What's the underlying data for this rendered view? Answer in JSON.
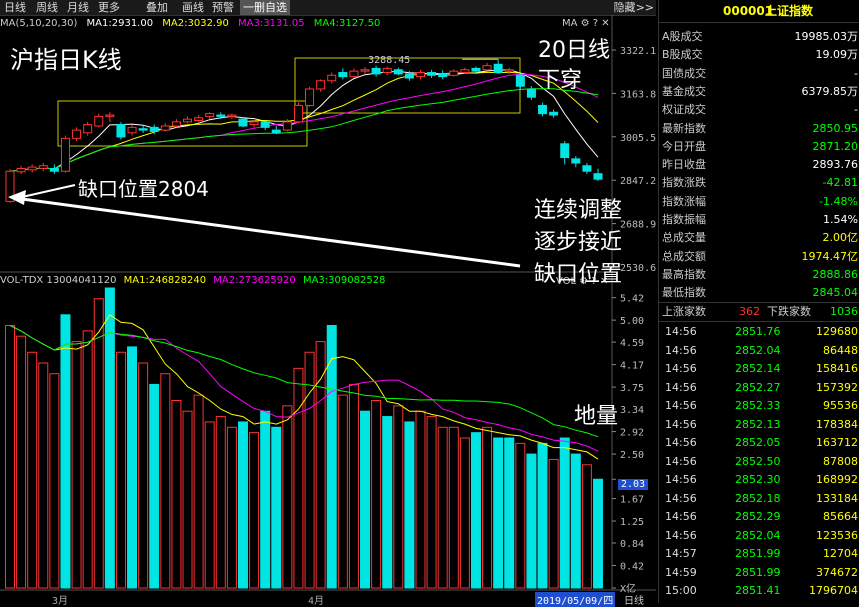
{
  "toolbar": {
    "tabs": [
      "日线",
      "周线",
      "月线",
      "更多",
      "叠加",
      "画线",
      "预警"
    ],
    "active_tab": "一删自选",
    "right_label": "隐藏",
    "right_arrows": ">>"
  },
  "kline": {
    "ma_legend": {
      "prefix": "MA(5,10,20,30)",
      "ma1": "MA1:2931.00",
      "ma2": "MA2:3032.90",
      "ma3": "MA3:3131.05",
      "ma4": "MA4:3127.50"
    },
    "price_axis": [
      "3322.13",
      "3163.84",
      "3005.55",
      "2847.26",
      "2688.98",
      "2530.69"
    ],
    "high_label": "3288.45",
    "top_icons": "MA ⚙ ? ✕"
  },
  "volume": {
    "legend": {
      "prefix": "VOL-TDX 13004041120",
      "ma1": "MA1:246828240",
      "ma2": "MA2:273625920",
      "ma3": "MA3:309082528"
    },
    "axis": [
      "5.42",
      "5.00",
      "4.59",
      "4.17",
      "3.75",
      "3.34",
      "2.92",
      "2.50",
      "2.03",
      "1.67",
      "1.25",
      "0.84",
      "0.42",
      "X亿"
    ],
    "current": "2.03",
    "top_icons": "VOL ⚙ ? ✕"
  },
  "date_axis": {
    "labels": [
      "3月",
      "4月"
    ],
    "current_date": "2019/05/09/四",
    "right_tab": "日线"
  },
  "annotations": {
    "title": "沪指日K线",
    "ma20_cross": [
      "20日线",
      "下穿"
    ],
    "gap": "缺口位置2804",
    "adjust": [
      "连续调整",
      "逐步接近",
      "缺口位置"
    ],
    "volume_note": "地量"
  },
  "colors": {
    "up": "#ff3232",
    "down": "#00e4e4",
    "ma1": "#ffffff",
    "ma2": "#ffff00",
    "ma3": "#ff00ff",
    "ma4": "#00ff00",
    "box": "#c8c800"
  },
  "panel": {
    "code": "000001",
    "name": "上证指数",
    "rows": [
      {
        "label": "A股成交",
        "value": "19985.03万",
        "color": "#ffffff"
      },
      {
        "label": "B股成交",
        "value": "19.09万",
        "color": "#ffffff"
      },
      {
        "label": "国债成交",
        "value": "-",
        "color": "#ffffff"
      },
      {
        "label": "基金成交",
        "value": "6379.85万",
        "color": "#ffffff"
      },
      {
        "label": "权证成交",
        "value": "-",
        "color": "#ffffff"
      },
      {
        "label": "最新指数",
        "value": "2850.95",
        "color": "#00ff00"
      },
      {
        "label": "今日开盘",
        "value": "2871.20",
        "color": "#00ff00"
      },
      {
        "label": "昨日收盘",
        "value": "2893.76",
        "color": "#ffffff"
      },
      {
        "label": "指数涨跌",
        "value": "-42.81",
        "color": "#00ff00"
      },
      {
        "label": "指数涨幅",
        "value": "-1.48%",
        "color": "#00ff00"
      },
      {
        "label": "指数振幅",
        "value": "1.54%",
        "color": "#ffffff"
      },
      {
        "label": "总成交量",
        "value": "2.00亿",
        "color": "#ffff00"
      },
      {
        "label": "总成交额",
        "value": "1974.47亿",
        "color": "#ffff00"
      },
      {
        "label": "最高指数",
        "value": "2888.86",
        "color": "#00ff00"
      },
      {
        "label": "最低指数",
        "value": "2845.04",
        "color": "#00ff00"
      }
    ],
    "rise_label": "上涨家数",
    "rise_value": "362",
    "fall_label": "下跌家数",
    "fall_value": "1036",
    "ticks": [
      {
        "time": "14:56",
        "price": "2851.76",
        "vol": "129680"
      },
      {
        "time": "14:56",
        "price": "2852.04",
        "vol": "86448"
      },
      {
        "time": "14:56",
        "price": "2852.14",
        "vol": "158416"
      },
      {
        "time": "14:56",
        "price": "2852.27",
        "vol": "157392"
      },
      {
        "time": "14:56",
        "price": "2852.33",
        "vol": "95536"
      },
      {
        "time": "14:56",
        "price": "2852.13",
        "vol": "178384"
      },
      {
        "time": "14:56",
        "price": "2852.05",
        "vol": "163712"
      },
      {
        "time": "14:56",
        "price": "2852.50",
        "vol": "87808"
      },
      {
        "time": "14:56",
        "price": "2852.30",
        "vol": "168992"
      },
      {
        "time": "14:56",
        "price": "2852.18",
        "vol": "133184"
      },
      {
        "time": "14:56",
        "price": "2852.29",
        "vol": "85664"
      },
      {
        "time": "14:56",
        "price": "2852.04",
        "vol": "123536"
      },
      {
        "time": "14:57",
        "price": "2851.99",
        "vol": "12704"
      },
      {
        "time": "14:59",
        "price": "2851.99",
        "vol": "374672"
      },
      {
        "time": "15:00",
        "price": "2851.41",
        "vol": "1796704"
      }
    ]
  },
  "chart_data": [
    {
      "type": "candlestick",
      "title": "",
      "price_axis_ticks": [
        3322.13,
        3163.84,
        3005.55,
        2847.26,
        2688.98,
        2530.69
      ],
      "ylim": [
        2530.69,
        3322.13
      ],
      "annotated_high": 3288.45,
      "gap_level": 2804,
      "candles": [
        {
          "o": 2770,
          "c": 2880,
          "h": 2888,
          "l": 2765
        },
        {
          "o": 2878,
          "c": 2890,
          "h": 2900,
          "l": 2870
        },
        {
          "o": 2885,
          "c": 2895,
          "h": 2905,
          "l": 2875
        },
        {
          "o": 2890,
          "c": 2900,
          "h": 2910,
          "l": 2880
        },
        {
          "o": 2890,
          "c": 2880,
          "h": 2905,
          "l": 2870
        },
        {
          "o": 2880,
          "c": 3000,
          "h": 3010,
          "l": 2875
        },
        {
          "o": 3000,
          "c": 3030,
          "h": 3040,
          "l": 2990
        },
        {
          "o": 3020,
          "c": 3050,
          "h": 3060,
          "l": 3010
        },
        {
          "o": 3045,
          "c": 3080,
          "h": 3090,
          "l": 3040
        },
        {
          "o": 3080,
          "c": 3085,
          "h": 3095,
          "l": 3060
        },
        {
          "o": 3050,
          "c": 3005,
          "h": 3060,
          "l": 2995
        },
        {
          "o": 3020,
          "c": 3040,
          "h": 3050,
          "l": 3010
        },
        {
          "o": 3035,
          "c": 3030,
          "h": 3045,
          "l": 3020
        },
        {
          "o": 3040,
          "c": 3025,
          "h": 3050,
          "l": 3015
        },
        {
          "o": 3030,
          "c": 3045,
          "h": 3055,
          "l": 3025
        },
        {
          "o": 3045,
          "c": 3060,
          "h": 3070,
          "l": 3040
        },
        {
          "o": 3060,
          "c": 3070,
          "h": 3080,
          "l": 3055
        },
        {
          "o": 3065,
          "c": 3075,
          "h": 3085,
          "l": 3060
        },
        {
          "o": 3080,
          "c": 3090,
          "h": 3095,
          "l": 3070
        },
        {
          "o": 3085,
          "c": 3080,
          "h": 3095,
          "l": 3070
        },
        {
          "o": 3080,
          "c": 3085,
          "h": 3090,
          "l": 3070
        },
        {
          "o": 3070,
          "c": 3045,
          "h": 3075,
          "l": 3040
        },
        {
          "o": 3050,
          "c": 3060,
          "h": 3065,
          "l": 3040
        },
        {
          "o": 3060,
          "c": 3040,
          "h": 3065,
          "l": 3030
        },
        {
          "o": 3030,
          "c": 3020,
          "h": 3045,
          "l": 3015
        },
        {
          "o": 3030,
          "c": 3060,
          "h": 3070,
          "l": 3025
        },
        {
          "o": 3060,
          "c": 3120,
          "h": 3130,
          "l": 3055
        },
        {
          "o": 3120,
          "c": 3180,
          "h": 3188,
          "l": 3115
        },
        {
          "o": 3180,
          "c": 3210,
          "h": 3215,
          "l": 3170
        },
        {
          "o": 3210,
          "c": 3230,
          "h": 3240,
          "l": 3200
        },
        {
          "o": 3240,
          "c": 3225,
          "h": 3255,
          "l": 3215
        },
        {
          "o": 3225,
          "c": 3245,
          "h": 3255,
          "l": 3220
        },
        {
          "o": 3245,
          "c": 3250,
          "h": 3260,
          "l": 3235
        },
        {
          "o": 3255,
          "c": 3235,
          "h": 3265,
          "l": 3225
        },
        {
          "o": 3240,
          "c": 3255,
          "h": 3262,
          "l": 3230
        },
        {
          "o": 3250,
          "c": 3235,
          "h": 3258,
          "l": 3230
        },
        {
          "o": 3235,
          "c": 3220,
          "h": 3245,
          "l": 3210
        },
        {
          "o": 3225,
          "c": 3240,
          "h": 3250,
          "l": 3215
        },
        {
          "o": 3240,
          "c": 3230,
          "h": 3250,
          "l": 3220
        },
        {
          "o": 3235,
          "c": 3225,
          "h": 3248,
          "l": 3215
        },
        {
          "o": 3230,
          "c": 3245,
          "h": 3252,
          "l": 3225
        },
        {
          "o": 3240,
          "c": 3250,
          "h": 3258,
          "l": 3235
        },
        {
          "o": 3255,
          "c": 3245,
          "h": 3262,
          "l": 3235
        },
        {
          "o": 3250,
          "c": 3265,
          "h": 3275,
          "l": 3245
        },
        {
          "o": 3270,
          "c": 3240,
          "h": 3288,
          "l": 3235
        },
        {
          "o": 3245,
          "c": 3250,
          "h": 3258,
          "l": 3235
        },
        {
          "o": 3230,
          "c": 3190,
          "h": 3235,
          "l": 3180
        },
        {
          "o": 3180,
          "c": 3150,
          "h": 3190,
          "l": 3140
        },
        {
          "o": 3120,
          "c": 3090,
          "h": 3130,
          "l": 3080
        },
        {
          "o": 3095,
          "c": 3085,
          "h": 3105,
          "l": 3075
        },
        {
          "o": 2980,
          "c": 2930,
          "h": 2990,
          "l": 2905
        },
        {
          "o": 2925,
          "c": 2910,
          "h": 2935,
          "l": 2895
        },
        {
          "o": 2900,
          "c": 2880,
          "h": 2910,
          "l": 2870
        },
        {
          "o": 2871,
          "c": 2851,
          "h": 2889,
          "l": 2845
        }
      ]
    },
    {
      "type": "bar",
      "title": "",
      "ylim": [
        0,
        5.42
      ],
      "unit": "亿",
      "values": [
        4.9,
        4.7,
        4.4,
        4.2,
        4.0,
        5.1,
        4.6,
        4.8,
        5.4,
        5.6,
        4.4,
        4.5,
        4.2,
        3.8,
        4.0,
        3.5,
        3.3,
        3.6,
        3.1,
        3.2,
        3.0,
        3.1,
        2.9,
        3.3,
        3.0,
        3.4,
        4.1,
        4.4,
        4.6,
        4.9,
        3.6,
        3.8,
        3.3,
        3.5,
        3.2,
        3.4,
        3.1,
        3.3,
        3.2,
        3.0,
        3.0,
        2.8,
        2.9,
        3.0,
        2.8,
        2.8,
        2.7,
        2.5,
        2.7,
        2.4,
        2.8,
        2.5,
        2.3,
        2.03
      ],
      "up": [
        true,
        true,
        true,
        true,
        true,
        false,
        true,
        true,
        true,
        false,
        true,
        false,
        true,
        false,
        true,
        true,
        true,
        true,
        true,
        true,
        true,
        false,
        true,
        false,
        false,
        true,
        true,
        true,
        true,
        false,
        true,
        true,
        false,
        true,
        false,
        true,
        false,
        true,
        true,
        true,
        true,
        true,
        false,
        true,
        false,
        false,
        true,
        false,
        false,
        true,
        false,
        false,
        true,
        false
      ]
    }
  ]
}
